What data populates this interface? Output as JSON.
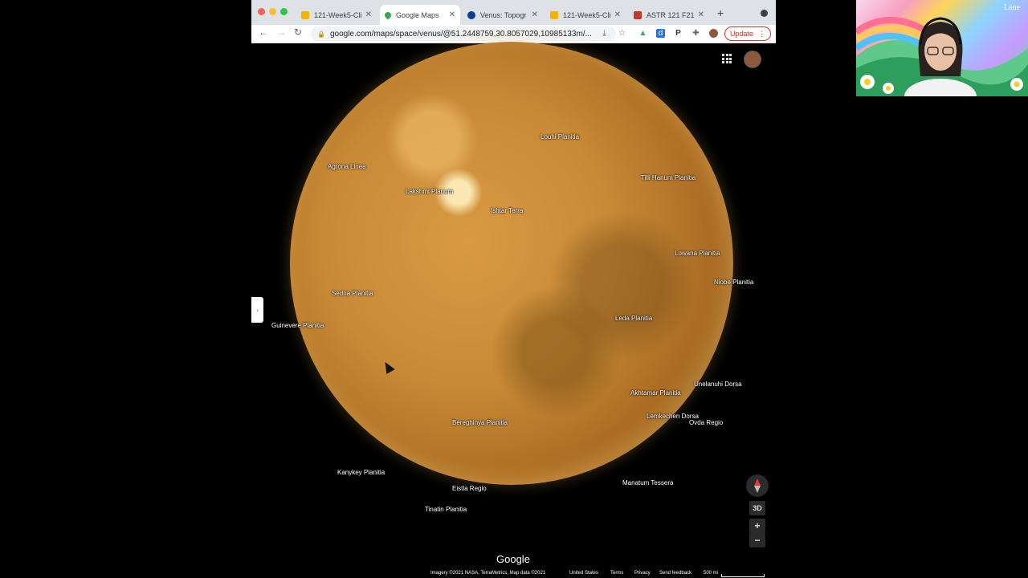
{
  "browser": {
    "tabs": [
      {
        "label": "121-Week5-Cli",
        "icon": "slides-icon",
        "color": "#f4b400"
      },
      {
        "label": "Google Maps",
        "icon": "maps-pin-icon",
        "color": "#34a853",
        "active": true
      },
      {
        "label": "Venus: Topogr",
        "icon": "nasa-icon",
        "color": "#0b3d91"
      },
      {
        "label": "121-Week5-Cli",
        "icon": "slides-icon",
        "color": "#f4b400"
      },
      {
        "label": "ASTR 121 F21",
        "icon": "course-icon",
        "color": "#c0392b"
      }
    ],
    "new_tab": "+",
    "url": "google.com/maps/space/venus/@51.2448759,30.8057029,10985133m/...",
    "update_label": "Update"
  },
  "map": {
    "labels": [
      {
        "id": "louhi",
        "text": "Louhi Planitia"
      },
      {
        "id": "agrona",
        "text": "Agrona Linea"
      },
      {
        "id": "tilli",
        "text": "Tilli Hanum Planitia"
      },
      {
        "id": "lakshmi",
        "text": "Lakshmi Planum"
      },
      {
        "id": "ishtar",
        "text": "Ishtar Terra"
      },
      {
        "id": "lowana",
        "text": "Lowana Planitia"
      },
      {
        "id": "niobe",
        "text": "Niobe Planitia"
      },
      {
        "id": "sedna",
        "text": "Sedna Planitia"
      },
      {
        "id": "leda",
        "text": "Leda Planitia"
      },
      {
        "id": "guinevere",
        "text": "Guinevere Planitia"
      },
      {
        "id": "unelanuhi",
        "text": "Unelanuhi Dorsa"
      },
      {
        "id": "akhtamar",
        "text": "Akhtamar Planitia"
      },
      {
        "id": "lemkechen",
        "text": "Lemkechen Dorsa"
      },
      {
        "id": "ovda",
        "text": "Ovda Regio"
      },
      {
        "id": "bereghinya",
        "text": "Bereghinya Planitia"
      },
      {
        "id": "kanykey",
        "text": "Kanykey Planitia"
      },
      {
        "id": "eistla",
        "text": "Eistla Regio"
      },
      {
        "id": "manatum",
        "text": "Manatum Tessera"
      },
      {
        "id": "tinatin",
        "text": "Tinatin Planitia"
      }
    ],
    "btn_3d": "3D",
    "zoom_in": "+",
    "zoom_out": "−",
    "brand": "Google",
    "footer": {
      "imagery": "Imagery ©2021 NASA, TerraMetrics, Map data ©2021",
      "country": "United States",
      "terms": "Terms",
      "privacy": "Privacy",
      "feedback": "Send feedback",
      "scale": "500 mi"
    }
  },
  "webcam": {
    "logo": "Lane"
  }
}
